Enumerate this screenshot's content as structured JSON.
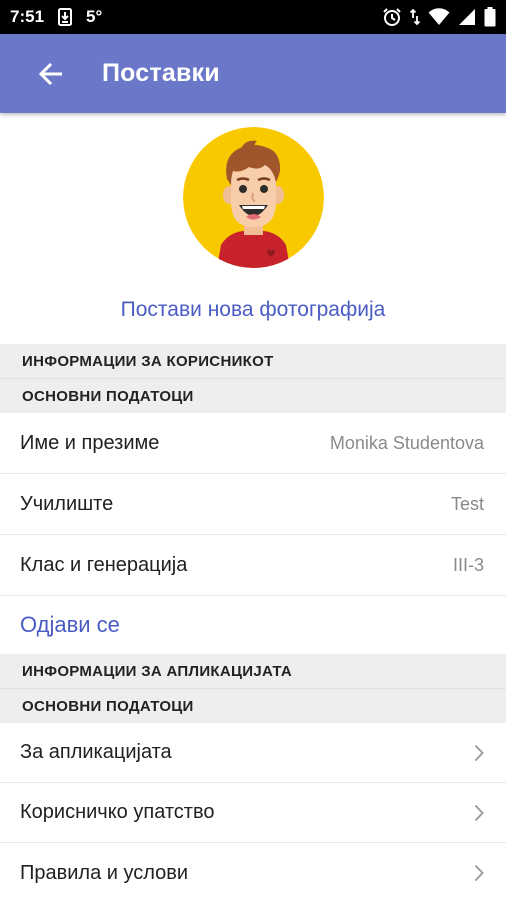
{
  "status_bar": {
    "time": "7:51",
    "temperature": "5°",
    "icons": [
      "download-icon",
      "alarm-icon",
      "data-arrows-icon",
      "wifi-icon",
      "signal-icon",
      "battery-icon"
    ]
  },
  "app_bar": {
    "title": "Поставки",
    "back_icon": "arrow-back-icon",
    "color": "#6b78c9"
  },
  "profile": {
    "set_photo_label": "Постави нова фотографија",
    "avatar_bg": "#f9c900"
  },
  "user_section": {
    "header": "ИНФОРМАЦИИ ЗА КОРИСНИКОТ",
    "subheader": "ОСНОВНИ ПОДАТОЦИ",
    "rows": [
      {
        "label": "Име и презиме",
        "value": "Monika Studentova"
      },
      {
        "label": "Училиште",
        "value": "Test"
      },
      {
        "label": "Клас и генерација",
        "value": "III-3"
      }
    ],
    "logout_label": "Одјави се"
  },
  "app_section": {
    "header": "ИНФОРМАЦИИ ЗА АПЛИКАЦИЈАТА",
    "subheader": "ОСНОВНИ ПОДАТОЦИ",
    "items": [
      {
        "label": "За апликацијата"
      },
      {
        "label": "Корисничко упатство"
      },
      {
        "label": "Правила и услови"
      }
    ]
  },
  "colors": {
    "accent": "#4a5cc4",
    "section_bg": "#eeeeee"
  }
}
